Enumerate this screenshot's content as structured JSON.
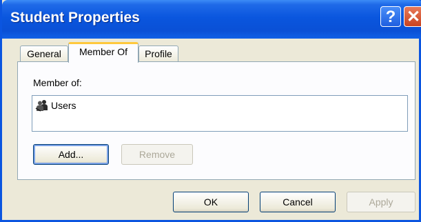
{
  "window": {
    "title": "Student Properties",
    "help_glyph": "?",
    "close_glyph": "✕"
  },
  "tabs": [
    {
      "label": "General"
    },
    {
      "label": "Member Of"
    },
    {
      "label": "Profile"
    }
  ],
  "member_of": {
    "label": "Member of:",
    "items": [
      {
        "name": "Users",
        "icon": "users-group-icon"
      }
    ]
  },
  "buttons": {
    "add": "Add...",
    "remove": "Remove",
    "ok": "OK",
    "cancel": "Cancel",
    "apply": "Apply"
  },
  "colors": {
    "titlebar": "#0a56de",
    "dialog_bg": "#ece9d8",
    "active_tab_accent": "#ffc83c"
  }
}
